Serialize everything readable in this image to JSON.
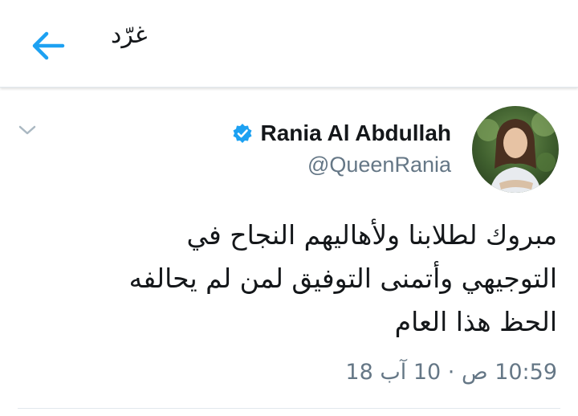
{
  "header": {
    "title": "غرّد",
    "back_icon": "arrow-left-icon"
  },
  "tweet": {
    "author": {
      "name": "Rania Al Abdullah",
      "handle": "@QueenRania",
      "verified": true
    },
    "text_lines": [
      "مبروك لطلابنا ولأهاليهم النجاح في",
      "التوجيهي وأتمنى التوفيق لمن لم يحالفه",
      "الحظ هذا العام"
    ],
    "timestamp": "10:59 ص · 10 آب 18"
  },
  "colors": {
    "accent": "#1da1f2",
    "text": "#14171a",
    "muted": "#657786",
    "divider": "#e1e8ed"
  }
}
